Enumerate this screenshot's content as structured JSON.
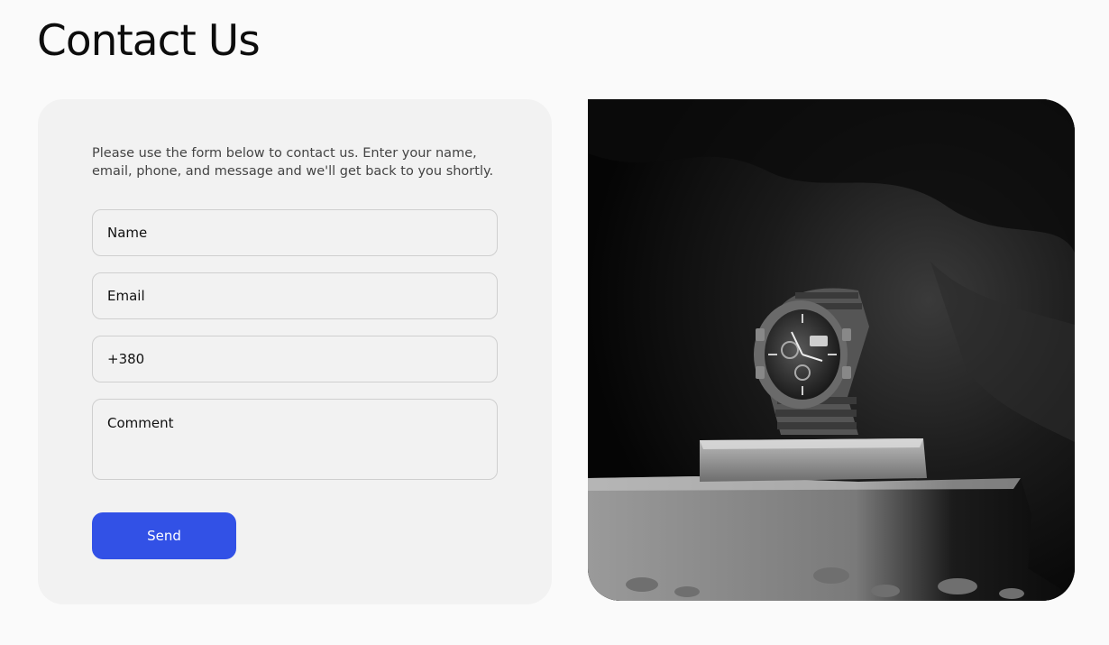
{
  "page": {
    "title": "Contact Us"
  },
  "form": {
    "intro": "Please use the form below to contact us. Enter your name, email, phone, and message and we'll get back to you shortly.",
    "name_placeholder": "Name",
    "email_placeholder": "Email",
    "phone_value": "+380",
    "comment_placeholder": "Comment",
    "send_label": "Send",
    "accent_color": "#3251e6"
  },
  "image": {
    "subject": "wristwatch-on-stone-photo"
  }
}
